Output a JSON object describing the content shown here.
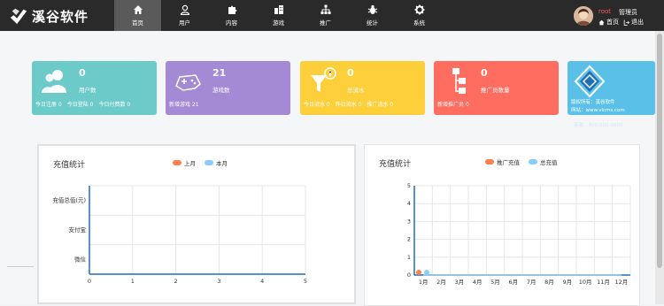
{
  "app": {
    "logo_text": "溪谷软件"
  },
  "nav": [
    {
      "label": "首页",
      "icon": "home-icon",
      "active": true
    },
    {
      "label": "用户",
      "icon": "user-icon",
      "active": false
    },
    {
      "label": "内容",
      "icon": "puzzle-icon",
      "active": false
    },
    {
      "label": "游戏",
      "icon": "building-icon",
      "active": false
    },
    {
      "label": "推广",
      "icon": "sitemap-icon",
      "active": false
    },
    {
      "label": "统计",
      "icon": "bug-icon",
      "active": false
    },
    {
      "label": "系统",
      "icon": "gear-icon",
      "active": false
    }
  ],
  "user": {
    "name": "root",
    "role": "管理员",
    "home_link": "首页",
    "logout_link": "退出"
  },
  "cards": [
    {
      "value": "0",
      "label": "用户数",
      "color": "#6ccac9",
      "icon": "users-icon",
      "footer": [
        "今日注册 0",
        "今日登陆 0",
        "今日付费数 0"
      ]
    },
    {
      "value": "21",
      "label": "游戏数",
      "color": "#a48ad4",
      "icon": "controller-icon",
      "footer": [
        "新增游戏 21"
      ]
    },
    {
      "value": "0",
      "label": "总流水",
      "color": "#fdd03b",
      "icon": "funnel-coin-icon",
      "footer": [
        "今日流水 0",
        "昨日流水 0",
        "推广流水 0"
      ]
    },
    {
      "value": "0",
      "label": "推广员数量",
      "color": "#ff6c60",
      "icon": "org-chart-icon",
      "footer": [
        "新增推广员 0"
      ]
    }
  ],
  "ad": {
    "line1": "版权所有：溪谷软件",
    "line2": "网站：www.vlcms.com",
    "line3": "客服：400-000-0000"
  },
  "charts": {
    "left": {
      "title": "充值统计",
      "legend": [
        "上月",
        "本月"
      ],
      "colors": [
        "#ff7f50",
        "#87cefa"
      ]
    },
    "right": {
      "title": "充值统计",
      "legend": [
        "推广充值",
        "总充值"
      ],
      "colors": [
        "#ff7f50",
        "#87cefa"
      ]
    }
  },
  "chart_data": [
    {
      "type": "bar",
      "orientation": "horizontal",
      "title": "充值统计",
      "categories": [
        "充值总值(元)",
        "支付宝",
        "微信"
      ],
      "series": [
        {
          "name": "上月",
          "values": [
            0,
            0,
            0
          ]
        },
        {
          "name": "本月",
          "values": [
            0,
            0,
            0
          ]
        }
      ],
      "xlim": [
        0,
        5
      ],
      "xticks": [
        "0",
        "1",
        "2",
        "3",
        "4",
        "5"
      ],
      "legend_position": "top",
      "grid": true
    },
    {
      "type": "line",
      "title": "充值统计",
      "categories": [
        "1月",
        "2月",
        "3月",
        "4月",
        "5月",
        "6月",
        "7月",
        "8月",
        "9月",
        "10月",
        "11月",
        "12月"
      ],
      "series": [
        {
          "name": "推广充值",
          "values": [
            0,
            0,
            0,
            0,
            0,
            0,
            0,
            0,
            0,
            0,
            0,
            0
          ]
        },
        {
          "name": "总充值",
          "values": [
            0,
            0,
            0,
            0,
            0,
            0,
            0,
            0,
            0,
            0,
            0,
            0
          ]
        }
      ],
      "ylim": [
        0,
        5
      ],
      "yticks": [
        "0",
        "1",
        "2",
        "3",
        "4",
        "5"
      ],
      "legend_position": "top",
      "grid": true
    }
  ]
}
